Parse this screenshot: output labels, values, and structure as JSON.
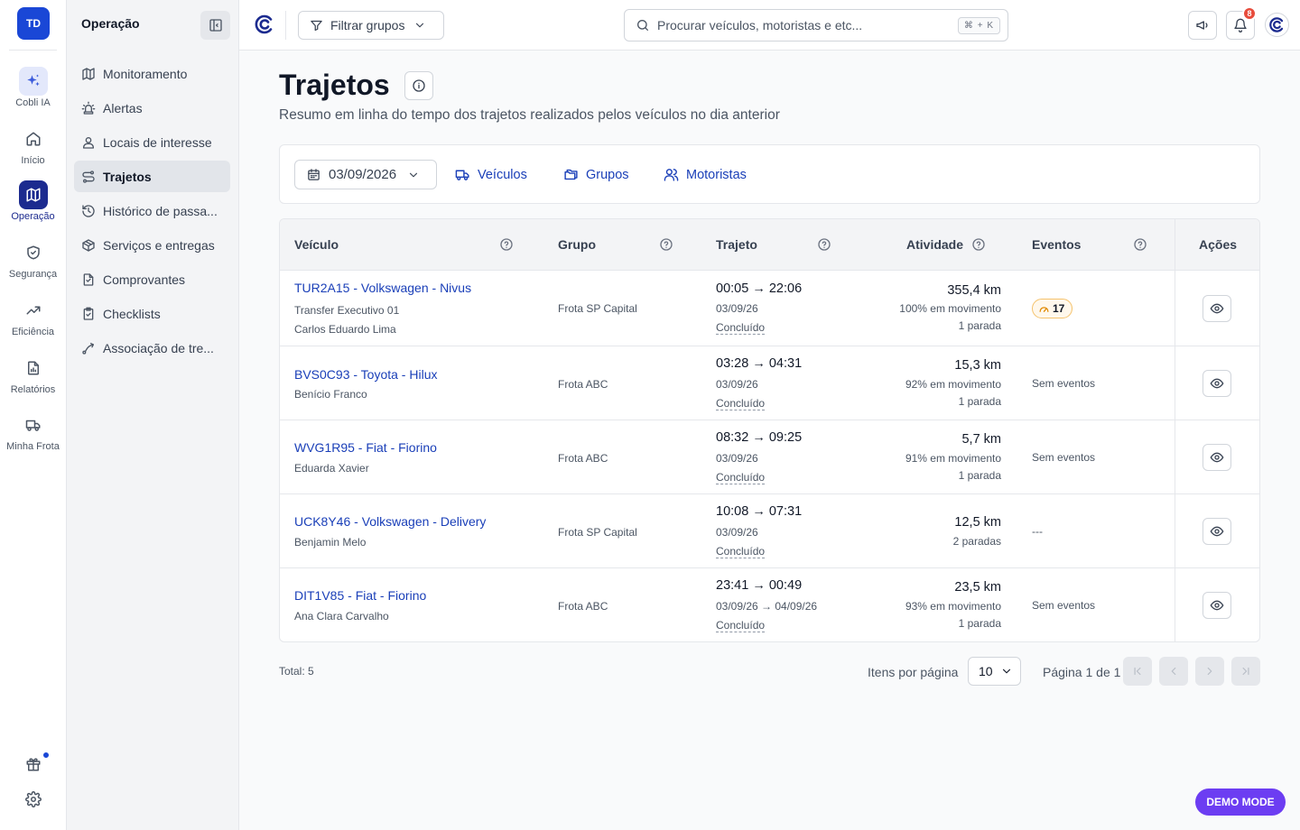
{
  "rail": {
    "avatar": "TD",
    "items": [
      {
        "label": "Cobli IA",
        "icon": "sparkle-icon"
      },
      {
        "label": "Início",
        "icon": "home-icon"
      },
      {
        "label": "Operação",
        "icon": "map-icon"
      },
      {
        "label": "Segurança",
        "icon": "shield-icon"
      },
      {
        "label": "Eficiência",
        "icon": "trend-icon"
      },
      {
        "label": "Relatórios",
        "icon": "report-icon"
      },
      {
        "label": "Minha Frota",
        "icon": "truck-icon"
      }
    ],
    "active": "Operação"
  },
  "sidebar": {
    "title": "Operação",
    "items": [
      {
        "label": "Monitoramento",
        "icon": "map-icon"
      },
      {
        "label": "Alertas",
        "icon": "siren-icon"
      },
      {
        "label": "Locais de interesse",
        "icon": "location-user-icon"
      },
      {
        "label": "Trajetos",
        "icon": "route-icon"
      },
      {
        "label": "Histórico de passa...",
        "icon": "history-icon"
      },
      {
        "label": "Serviços e entregas",
        "icon": "package-icon"
      },
      {
        "label": "Comprovantes",
        "icon": "receipt-icon"
      },
      {
        "label": "Checklists",
        "icon": "clipboard-icon"
      },
      {
        "label": "Associação de tre...",
        "icon": "link-icon"
      }
    ],
    "active": "Trajetos"
  },
  "topbar": {
    "filter_label": "Filtrar grupos",
    "search_placeholder": "Procurar veículos, motoristas e etc...",
    "search_shortcut": "⌘ + K",
    "notifications_count": "8"
  },
  "page": {
    "title": "Trajetos",
    "subtitle": "Resumo em linha do tempo dos trajetos realizados pelos veículos no dia anterior"
  },
  "filters": {
    "date": "03/09/2026",
    "tabs": [
      "Veículos",
      "Grupos",
      "Motoristas"
    ]
  },
  "table": {
    "headers": {
      "vehicle": "Veículo",
      "group": "Grupo",
      "route": "Trajeto",
      "activity": "Atividade",
      "events": "Eventos",
      "actions": "Ações"
    },
    "rows": [
      {
        "vehicle": "TUR2A15 - Volkswagen - Nivus",
        "sublines": [
          "Transfer Executivo 01",
          "Carlos Eduardo Lima"
        ],
        "group": "Frota SP Capital",
        "time": "00:05 → 22:06",
        "date": "03/09/26",
        "status": "Concluído",
        "km": "355,4 km",
        "movement": "100% em movimento",
        "stops": "1 parada",
        "events_count": "17",
        "events_text": ""
      },
      {
        "vehicle": "BVS0C93 - Toyota - Hilux",
        "sublines": [
          "Benício Franco"
        ],
        "group": "Frota ABC",
        "time": "03:28 → 04:31",
        "date": "03/09/26",
        "status": "Concluído",
        "km": "15,3 km",
        "movement": "92% em movimento",
        "stops": "1 parada",
        "events_count": "",
        "events_text": "Sem eventos"
      },
      {
        "vehicle": "WVG1R95 - Fiat - Fiorino",
        "sublines": [
          "Eduarda Xavier"
        ],
        "group": "Frota ABC",
        "time": "08:32 → 09:25",
        "date": "03/09/26",
        "status": "Concluído",
        "km": "5,7 km",
        "movement": "91% em movimento",
        "stops": "1 parada",
        "events_count": "",
        "events_text": "Sem eventos"
      },
      {
        "vehicle": "UCK8Y46 - Volkswagen - Delivery",
        "sublines": [
          "Benjamin Melo"
        ],
        "group": "Frota SP Capital",
        "time": "10:08 → 07:31",
        "date": "03/09/26",
        "status": "Concluído",
        "km": "12,5 km",
        "movement": "",
        "stops": "2 paradas",
        "events_count": "",
        "events_text": "---"
      },
      {
        "vehicle": "DIT1V85 - Fiat - Fiorino",
        "sublines": [
          "Ana Clara Carvalho"
        ],
        "group": "Frota ABC",
        "time": "23:41 → 00:49",
        "date": "03/09/26 → 04/09/26",
        "status": "Concluído",
        "km": "23,5 km",
        "movement": "93% em movimento",
        "stops": "1 parada",
        "events_count": "",
        "events_text": "Sem eventos"
      }
    ]
  },
  "footer": {
    "total": "Total: 5",
    "items_per_page_label": "Itens por página",
    "items_per_page": "10",
    "page_info": "Página 1 de 1"
  },
  "demo_mode": "DEMO MODE",
  "colors": {
    "brand": "#1a47d6",
    "link": "#1a3fb8",
    "rail_active": "#1c2b8f",
    "demo": "#6c3df2",
    "badge": "#e74c3c"
  }
}
